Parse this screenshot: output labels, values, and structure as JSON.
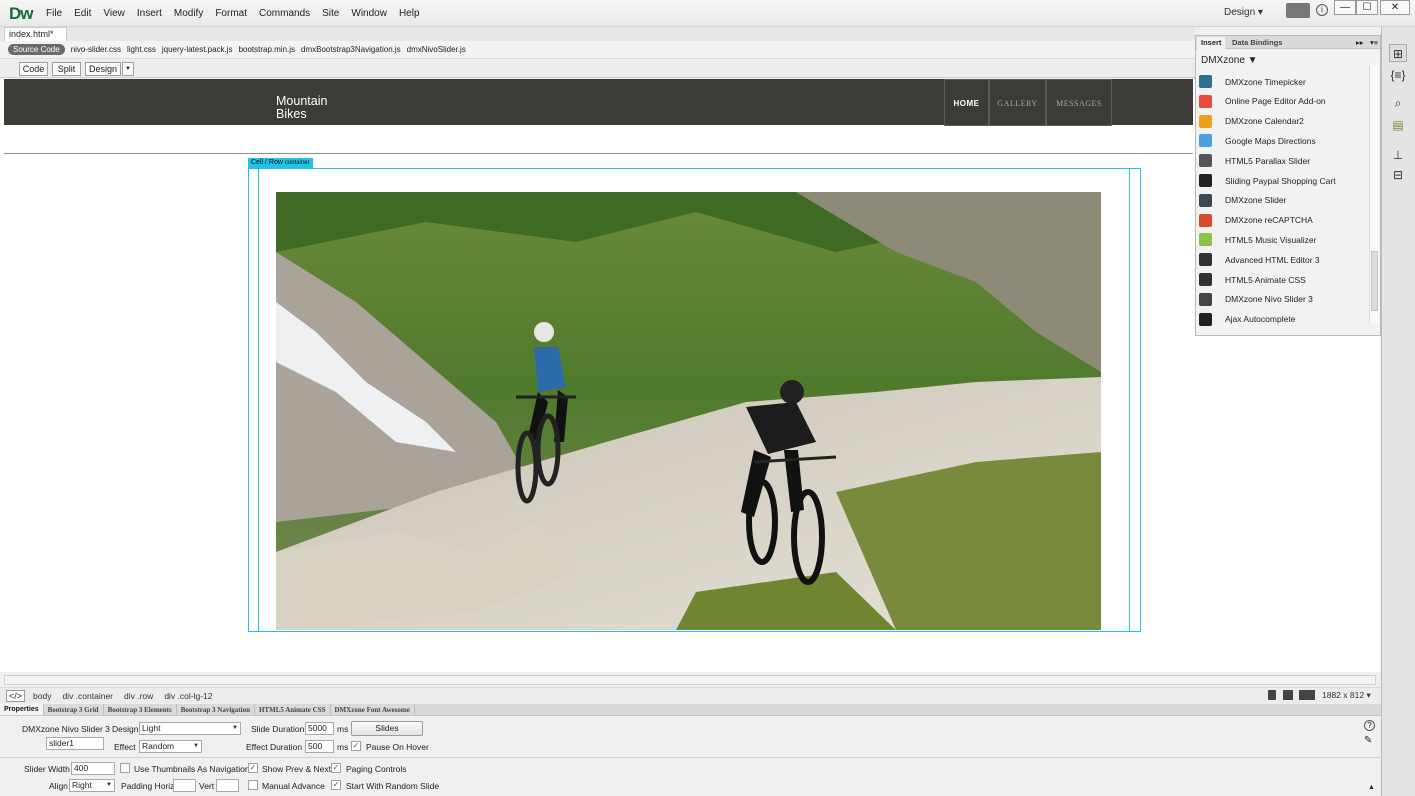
{
  "app": {
    "logo": "Dw",
    "menu": [
      "File",
      "Edit",
      "View",
      "Insert",
      "Modify",
      "Format",
      "Commands",
      "Site",
      "Window",
      "Help"
    ],
    "workspace": "Design",
    "window_controls": [
      "—",
      "☐",
      "✕"
    ]
  },
  "document": {
    "tab_label": "index.html*",
    "tab_close": "×",
    "source_code_label": "Source Code",
    "related_files": [
      "nivo-slider.css",
      "light.css",
      "jquery-latest.pack.js",
      "bootstrap.min.js",
      "dmxBootstrap3Navigation.js",
      "dmxNivoSlider.js"
    ],
    "view_buttons": [
      "Code",
      "Split",
      "Design"
    ]
  },
  "site": {
    "brand_line1": "Mountain",
    "brand_line2": "Bikes",
    "nav": [
      "HOME",
      "GALLERY",
      "MESSAGES"
    ],
    "active_nav": "HOME",
    "cell_row_label": "Cell / Row",
    "cell_row_tag": "container"
  },
  "insert_panel": {
    "tabs": [
      "Insert",
      "Data Bindings"
    ],
    "category": "DMXzone",
    "items": [
      {
        "label": "DMXzone Timepicker",
        "icon": "clock-icon",
        "color": "#2f6f8f"
      },
      {
        "label": "Online Page Editor Add-on",
        "icon": "editor-icon",
        "color": "#e64a3a"
      },
      {
        "label": "DMXzone Calendar2",
        "icon": "calendar-icon",
        "color": "#f0a020"
      },
      {
        "label": "Google Maps Directions",
        "icon": "map-icon",
        "color": "#4aa0d8"
      },
      {
        "label": "HTML5 Parallax Slider",
        "icon": "parallax-icon",
        "color": "#555555"
      },
      {
        "label": "Sliding Paypal Shopping Cart",
        "icon": "cart-icon",
        "color": "#222222"
      },
      {
        "label": "DMXzone Slider",
        "icon": "slider-icon",
        "color": "#3c4a52"
      },
      {
        "label": "DMXzone reCAPTCHA",
        "icon": "recaptcha-icon",
        "color": "#d94c2a"
      },
      {
        "label": "HTML5 Music Visualizer",
        "icon": "music-icon",
        "color": "#8bc34a"
      },
      {
        "label": "Advanced HTML Editor 3",
        "icon": "html-editor-icon",
        "color": "#333333"
      },
      {
        "label": "HTML5 Animate CSS",
        "icon": "animate-icon",
        "color": "#333333"
      },
      {
        "label": "DMXzone Nivo Slider 3",
        "icon": "nivo-icon",
        "color": "#444444"
      },
      {
        "label": "Ajax Autocomplete",
        "icon": "search-icon",
        "color": "#222222"
      }
    ]
  },
  "tag_selector": {
    "code_icon": "</>",
    "tags": [
      "body",
      "div .container",
      "div .row",
      "div .col-lg-12"
    ],
    "window_size": "1882 x 812"
  },
  "properties": {
    "tabs": [
      "Properties",
      "Bootstrap 3 Grid",
      "Bootstrap 3 Elements",
      "Bootstrap 3 Navigation",
      "HTML5 Animate CSS",
      "DMXzone Font Awesome"
    ],
    "component_name": "DMXzone Nivo Slider 3",
    "id_value": "slider1",
    "design_label": "Design",
    "design_value": "Light",
    "effect_label": "Effect",
    "effect_value": "Random",
    "slide_duration_label": "Slide Duration",
    "slide_duration_value": "5000",
    "ms": "ms",
    "effect_duration_label": "Effect Duration",
    "effect_duration_value": "500",
    "slides_button": "Slides",
    "pause_on_hover_label": "Pause On Hover",
    "pause_on_hover": true,
    "slider_width_label": "Slider Width",
    "slider_width_value": "400",
    "use_thumbnails_label": "Use Thumbnails As Navigation",
    "use_thumbnails": false,
    "show_prev_next_label": "Show Prev & Next",
    "show_prev_next": true,
    "paging_controls_label": "Paging Controls",
    "paging_controls": true,
    "align_label": "Align",
    "align_value": "Right",
    "padding_horiz_label": "Padding Horiz",
    "vert_label": "Vert",
    "manual_advance_label": "Manual Advance",
    "manual_advance": false,
    "random_slide_label": "Start With Random Slide",
    "random_slide": true
  },
  "colors": {
    "accent": "#21c1e8",
    "nav_bg": "#3c3b37",
    "logo": "#1e6a3a"
  }
}
